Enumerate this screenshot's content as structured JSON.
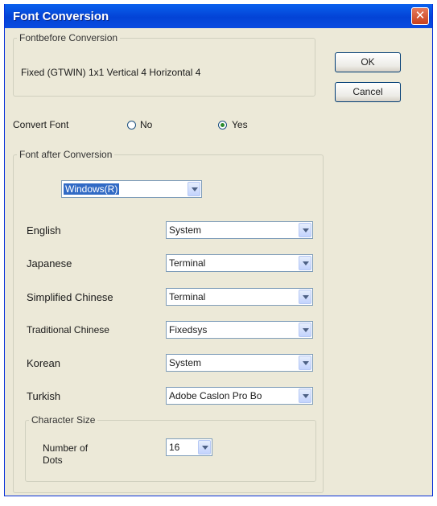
{
  "window": {
    "title": "Font Conversion",
    "close_glyph": "✕"
  },
  "before": {
    "legend": "Fontbefore Conversion",
    "value": "Fixed (GTWIN) 1x1 Vertical 4 Horizontal 4"
  },
  "buttons": {
    "ok": "OK",
    "cancel": "Cancel"
  },
  "convert": {
    "label": "Convert Font",
    "no": "No",
    "yes": "Yes",
    "selected": "Yes"
  },
  "after": {
    "legend": "Font after Conversion",
    "source": "Windows(R)",
    "rows": [
      {
        "label": "English",
        "value": "System"
      },
      {
        "label": "Japanese",
        "value": "Terminal"
      },
      {
        "label": "Simplified Chinese",
        "value": "Terminal"
      },
      {
        "label": "Traditional Chinese",
        "value": "Fixedsys"
      },
      {
        "label": "Korean",
        "value": "System"
      },
      {
        "label": "Turkish",
        "value": "Adobe Caslon Pro Bo"
      }
    ]
  },
  "char_size": {
    "legend": "Character Size",
    "label_line1": "Number of",
    "label_line2": "Dots",
    "value": "16"
  },
  "colors": {
    "titlebar": "#0a4be0",
    "dialog_bg": "#ece9d8",
    "selection": "#316ac5"
  }
}
